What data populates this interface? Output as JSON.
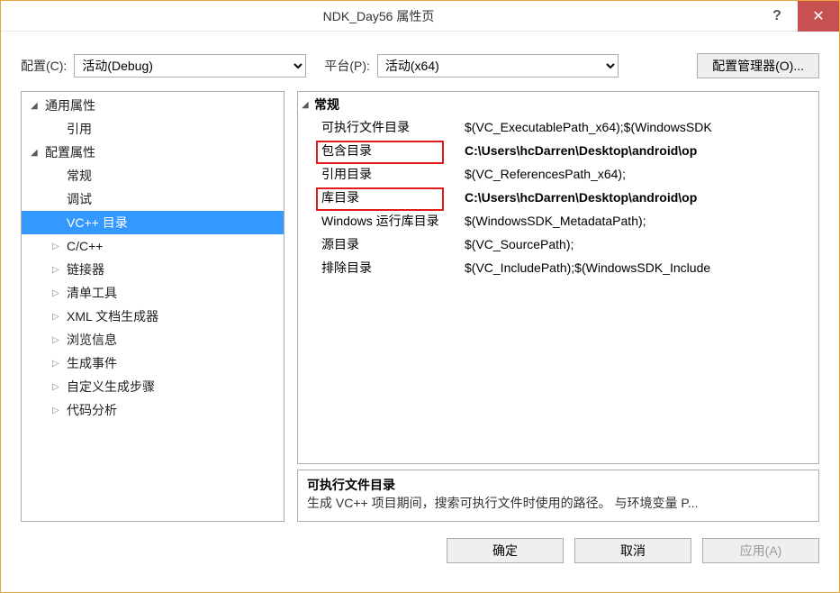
{
  "title": "NDK_Day56 属性页",
  "toolbar": {
    "config_label": "配置(C):",
    "config_value": "活动(Debug)",
    "platform_label": "平台(P):",
    "platform_value": "活动(x64)",
    "config_mgr": "配置管理器(O)..."
  },
  "tree": [
    {
      "depth": 1,
      "arrow": "open",
      "label": "通用属性"
    },
    {
      "depth": 2,
      "arrow": "none",
      "label": "引用"
    },
    {
      "depth": 1,
      "arrow": "open",
      "label": "配置属性"
    },
    {
      "depth": 2,
      "arrow": "none",
      "label": "常规"
    },
    {
      "depth": 2,
      "arrow": "none",
      "label": "调试"
    },
    {
      "depth": 2,
      "arrow": "none",
      "label": "VC++ 目录",
      "selected": true
    },
    {
      "depth": 2,
      "arrow": "closed",
      "label": "C/C++"
    },
    {
      "depth": 2,
      "arrow": "closed",
      "label": "链接器"
    },
    {
      "depth": 2,
      "arrow": "closed",
      "label": "清单工具"
    },
    {
      "depth": 2,
      "arrow": "closed",
      "label": "XML 文档生成器"
    },
    {
      "depth": 2,
      "arrow": "closed",
      "label": "浏览信息"
    },
    {
      "depth": 2,
      "arrow": "closed",
      "label": "生成事件"
    },
    {
      "depth": 2,
      "arrow": "closed",
      "label": "自定义生成步骤"
    },
    {
      "depth": 2,
      "arrow": "closed",
      "label": "代码分析"
    }
  ],
  "grid": {
    "category": "常规",
    "rows": [
      {
        "key": "可执行文件目录",
        "val": "$(VC_ExecutablePath_x64);$(WindowsSDK",
        "bold": false
      },
      {
        "key": "包含目录",
        "val": "C:\\Users\\hcDarren\\Desktop\\android\\op",
        "bold": true,
        "hl": true
      },
      {
        "key": "引用目录",
        "val": "$(VC_ReferencesPath_x64);",
        "bold": false
      },
      {
        "key": "库目录",
        "val": "C:\\Users\\hcDarren\\Desktop\\android\\op",
        "bold": true,
        "hl": true
      },
      {
        "key": "Windows 运行库目录",
        "val": "$(WindowsSDK_MetadataPath);",
        "bold": false
      },
      {
        "key": "源目录",
        "val": "$(VC_SourcePath);",
        "bold": false
      },
      {
        "key": "排除目录",
        "val": "$(VC_IncludePath);$(WindowsSDK_Include",
        "bold": false
      }
    ]
  },
  "desc": {
    "title": "可执行文件目录",
    "text": "生成 VC++ 项目期间，搜索可执行文件时使用的路径。    与环境变量 P..."
  },
  "footer": {
    "ok": "确定",
    "cancel": "取消",
    "apply": "应用(A)"
  }
}
